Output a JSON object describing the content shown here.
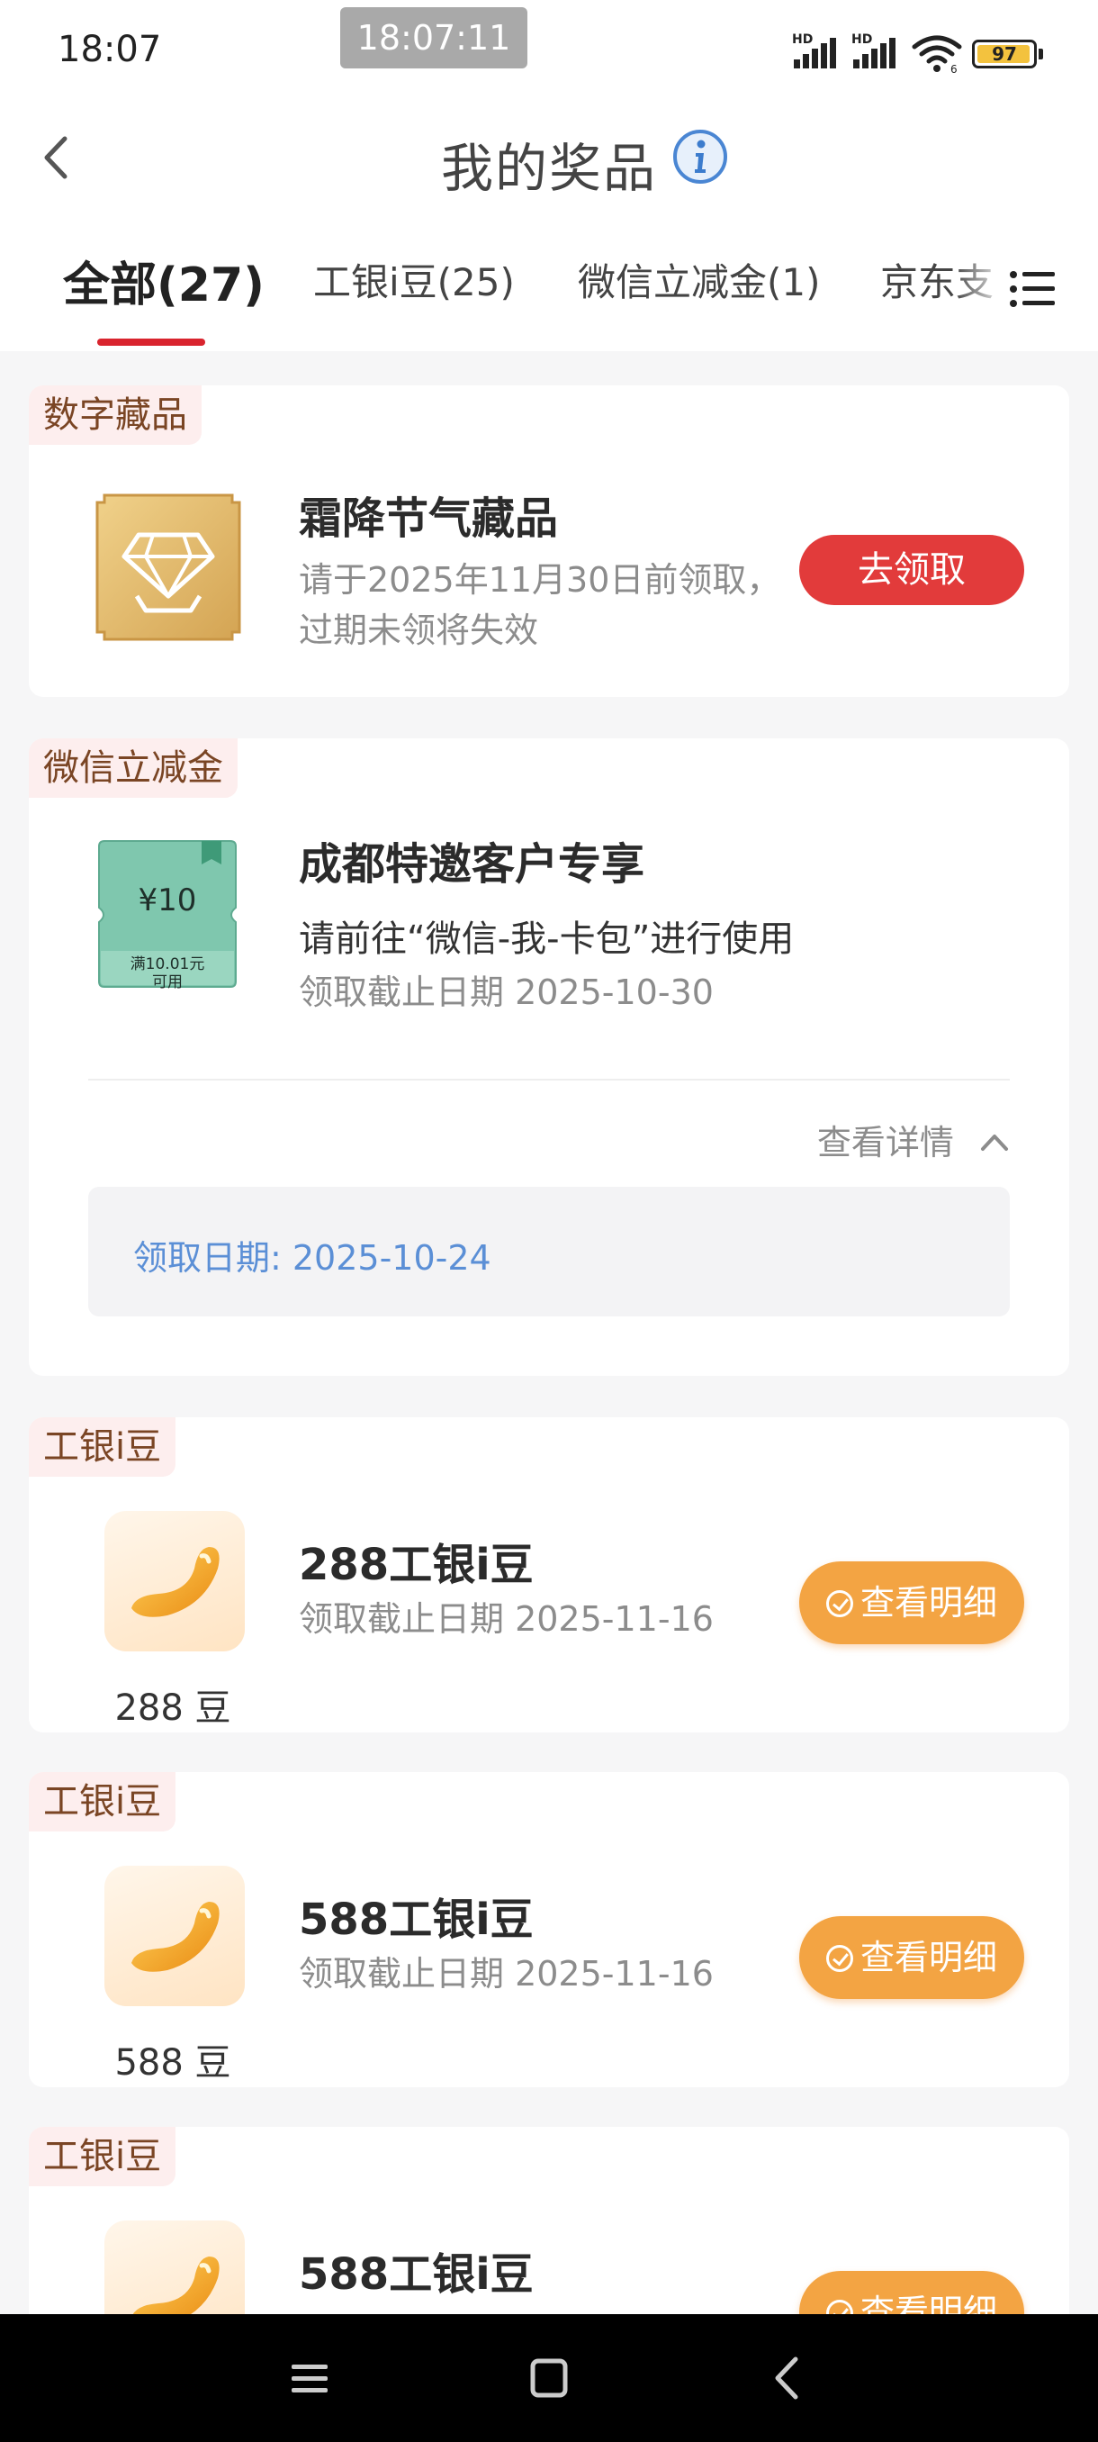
{
  "status_bar": {
    "time": "18:07",
    "overlay_time": "18:07:11",
    "sim1_label": "HD",
    "sim2_label": "HD",
    "battery_level": "97",
    "battery_percent": 97,
    "icons": [
      "signal-icon",
      "signal-icon",
      "wifi-icon",
      "battery-icon"
    ]
  },
  "header": {
    "title": "我的奖品",
    "back_icon": "chevron-left-icon",
    "info_icon": "info-icon"
  },
  "tabs": [
    {
      "label": "全部(27)",
      "active": true
    },
    {
      "label": "工银i豆(25)",
      "active": false
    },
    {
      "label": "微信立减金(1)",
      "active": false
    },
    {
      "label": "京东支",
      "active": false
    }
  ],
  "tab_menu_icon": "list-menu-icon",
  "cards": {
    "digital": {
      "tag": "数字藏品",
      "title": "霜降节气藏品",
      "subtitle_line1": "请于2025年11月30日前领取，",
      "subtitle_line2": "过期未领将失效",
      "button": "去领取",
      "image_icon": "diamond-collectible-icon"
    },
    "wechat": {
      "tag": "微信立减金",
      "title": "成都特邀客户专享",
      "desc": "请前往“微信-我-卡包”进行使用",
      "deadline": "领取截止日期 2025-10-30",
      "coupon_amount": "¥10",
      "coupon_condition_line1": "满10.01元",
      "coupon_condition_line2": "可用",
      "detail_toggle": "查看详情",
      "detail_text": "领取日期: 2025-10-24",
      "image_icon": "coupon-ticket-icon"
    },
    "bean_cards": [
      {
        "tag": "工银i豆",
        "title": "288工银i豆",
        "deadline": "领取截止日期 2025-11-16",
        "count": "288 豆",
        "button": "查看明细"
      },
      {
        "tag": "工银i豆",
        "title": "588工银i豆",
        "deadline": "领取截止日期 2025-11-16",
        "count": "588 豆",
        "button": "查看明细"
      },
      {
        "tag": "工银i豆",
        "title": "588工银i豆",
        "deadline": "",
        "count": "",
        "button": "查看明细"
      }
    ]
  },
  "nav_bar": {
    "icons": [
      "menu-nav-icon",
      "home-nav-icon",
      "back-nav-icon"
    ]
  },
  "colors": {
    "accent_red": "#d9242e",
    "button_red": "#e23b3b",
    "button_orange": "#f3a443",
    "tag_bg": "#fdeeee",
    "link_blue": "#5b8fd6"
  }
}
